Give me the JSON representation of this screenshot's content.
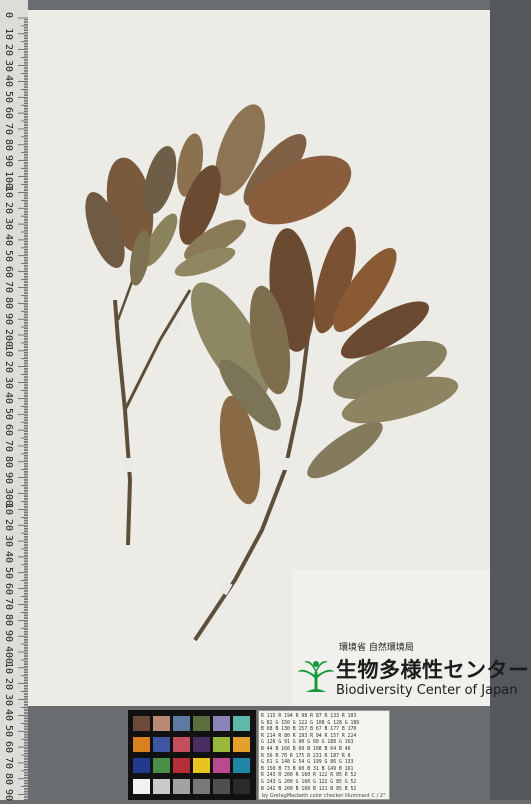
{
  "image": {
    "subject": "herbarium specimen sheet with leafy branches",
    "palette": {
      "background": "#6a6d70",
      "paper": "#ecebe6",
      "leaf_dark": "#7a5a3c",
      "leaf_light": "#8e8764",
      "stem": "#5e4f3b",
      "logo_green": "#169a3e"
    }
  },
  "ruler": {
    "labels": [
      "0",
      "10",
      "20",
      "30",
      "40",
      "50",
      "60",
      "70",
      "80",
      "90",
      "100",
      "10",
      "20",
      "30",
      "40",
      "50",
      "60",
      "70",
      "80",
      "90",
      "200",
      "10",
      "20",
      "30",
      "40",
      "50",
      "60",
      "70",
      "80",
      "90",
      "300",
      "10",
      "20",
      "30",
      "40",
      "50",
      "60",
      "70",
      "80",
      "90",
      "400",
      "10",
      "20",
      "30",
      "40",
      "50",
      "60",
      "70",
      "80",
      "90",
      "500"
    ]
  },
  "logo": {
    "gov_text": "環境省 自然環境局",
    "jp_name": "生物多様性センター",
    "en_name": "Biodiversity Center of Japan"
  },
  "color_checker": {
    "patches": [
      "#6b4a3a",
      "#b98a74",
      "#5c7aa2",
      "#5a6e3e",
      "#8a85b8",
      "#5fb9aa",
      "#d9801f",
      "#3d57a2",
      "#c24e5e",
      "#4a2e62",
      "#98b83c",
      "#e1a12a",
      "#213a8e",
      "#4a8f46",
      "#b52d36",
      "#e8c51e",
      "#b94a8e",
      "#1f86a8",
      "#f2f2f0",
      "#c9c9c8",
      "#a2a2a2",
      "#787878",
      "#4f4f50",
      "#2a2a2b"
    ]
  },
  "data_card": {
    "rows": [
      "R 115  R 194  R  98  R  87  R 133  R 103",
      "G  82  G 150  G 122  G 108  G 128  G 189",
      "B  68  B 130  B 157  B  67  B 177  B 170",
      "R 214  R  80  R 193  R  94  R 157  R 224",
      "G 126  G  91  G  90  G  60  G 188  G 163",
      "B  44  B 166  B  99  B 108  B  64  B  46",
      "R  56  R  70  R 175  R 231  R 187  R   8",
      "G  61  G 148  G  54  G 199  G  86  G 133",
      "B 150  B  73  B  60  B  31  B 149  B 161",
      "R 243  R 200  R 160  R 122  R  85  R  52",
      "G 243  G 200  G 160  G 122  G  85  G  52",
      "B 242  B 200  B 160  B 121  B  85  B  52"
    ],
    "caption": "by GretagMacbeth color checker  illuminant C / 2°"
  }
}
